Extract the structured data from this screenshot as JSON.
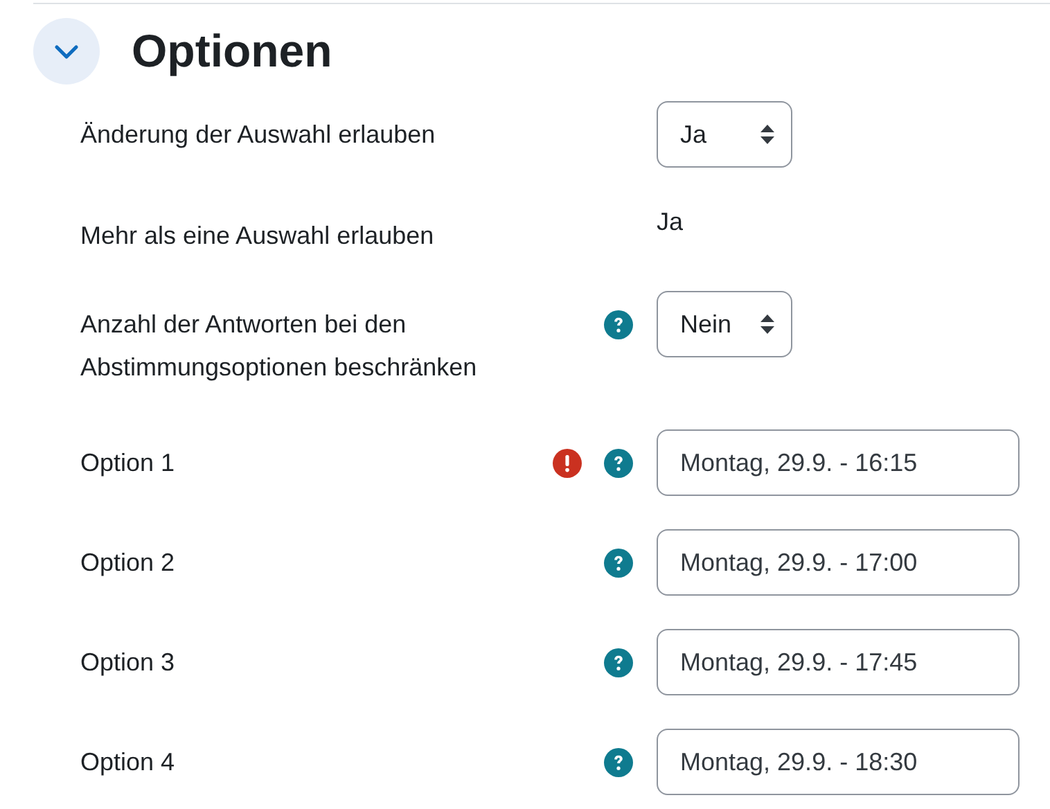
{
  "section": {
    "title": "Optionen",
    "expanded": true
  },
  "fields": [
    {
      "kind": "select",
      "label": "Änderung der Auswahl erlauben",
      "help": false,
      "error": false,
      "value": "Ja"
    },
    {
      "kind": "static",
      "label": "Mehr als eine Auswahl erlauben",
      "help": false,
      "error": false,
      "value": "Ja"
    },
    {
      "kind": "select",
      "label": "Anzahl der Antworten bei den Abstimmungsoptionen beschränken",
      "help": true,
      "error": false,
      "value": "Nein"
    },
    {
      "kind": "input",
      "label": "Option 1",
      "help": true,
      "error": true,
      "value": "Montag, 29.9. - 16:15"
    },
    {
      "kind": "input",
      "label": "Option 2",
      "help": true,
      "error": false,
      "value": "Montag, 29.9. - 17:00"
    },
    {
      "kind": "input",
      "label": "Option 3",
      "help": true,
      "error": false,
      "value": "Montag, 29.9. - 17:45"
    },
    {
      "kind": "input",
      "label": "Option 4",
      "help": true,
      "error": false,
      "value": "Montag, 29.9. - 18:30"
    }
  ]
}
